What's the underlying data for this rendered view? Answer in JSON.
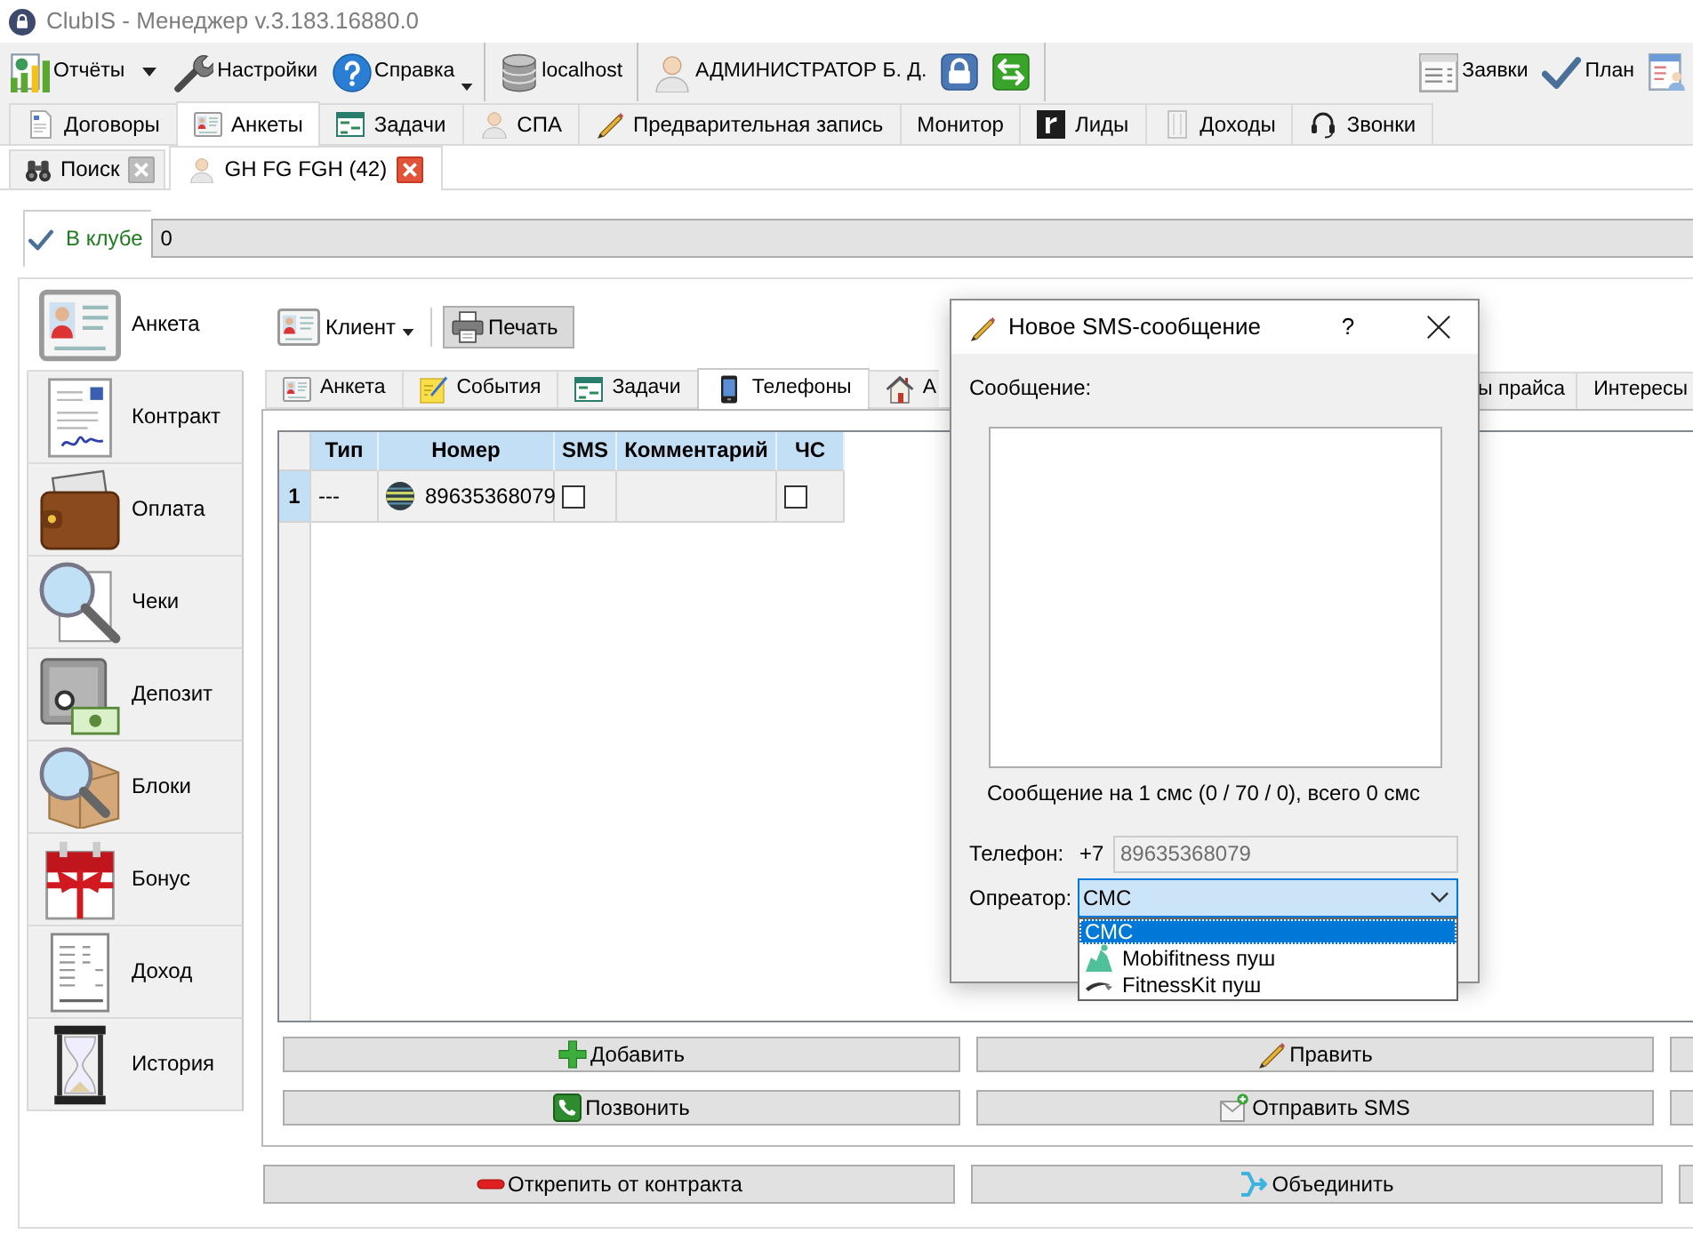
{
  "window": {
    "title": "ClubIS - Менеджер v.3.183.16880.0"
  },
  "toolbar": {
    "left": [
      {
        "kind": "split",
        "label": "Отчёты"
      },
      {
        "kind": "plain",
        "label": "Настройки"
      },
      {
        "kind": "menu",
        "label": "Справка"
      },
      {
        "kind": "separator"
      },
      {
        "kind": "plain",
        "label": "localhost"
      },
      {
        "kind": "separator"
      },
      {
        "kind": "plain",
        "label": "АДМИНИСТРАТОР Б. Д."
      },
      {
        "kind": "icon"
      },
      {
        "kind": "icon"
      },
      {
        "kind": "separator"
      }
    ],
    "right": [
      {
        "kind": "plain",
        "label": "Заявки"
      },
      {
        "kind": "plain",
        "label": "План"
      },
      {
        "kind": "icon"
      }
    ]
  },
  "main_tabs": [
    {
      "label": "Договоры",
      "selected": false
    },
    {
      "label": "Анкеты",
      "selected": true
    },
    {
      "label": "Задачи",
      "selected": false
    },
    {
      "label": "СПА",
      "selected": false
    },
    {
      "label": "Предварительная запись",
      "selected": false
    },
    {
      "label": "Монитор",
      "selected": false
    },
    {
      "label": "Лиды",
      "selected": false
    },
    {
      "label": "Доходы",
      "selected": false
    },
    {
      "label": "Звонки",
      "selected": false
    }
  ],
  "document_tabs": [
    {
      "label": "Поиск",
      "selected": false
    },
    {
      "label": "GH FG FGH (42)",
      "selected": true
    }
  ],
  "club_status": {
    "label": "В клубе",
    "value": "0"
  },
  "sidebar": {
    "items": [
      {
        "label": "Анкета",
        "selected": true
      },
      {
        "label": "Контракт",
        "selected": false
      },
      {
        "label": "Оплата",
        "selected": false
      },
      {
        "label": "Чеки",
        "selected": false
      },
      {
        "label": "Депозит",
        "selected": false
      },
      {
        "label": "Блоки",
        "selected": false
      },
      {
        "label": "Бонус",
        "selected": false
      },
      {
        "label": "Доход",
        "selected": false
      },
      {
        "label": "История",
        "selected": false
      }
    ]
  },
  "client_toolbar": [
    {
      "kind": "menu",
      "label": "Клиент"
    },
    {
      "kind": "button",
      "label": "Печать"
    }
  ],
  "client_tabs": [
    {
      "kind": "tab",
      "label": "Анкета",
      "selected": false
    },
    {
      "kind": "tab",
      "label": "События",
      "selected": false
    },
    {
      "kind": "tab",
      "label": "Задачи",
      "selected": false
    },
    {
      "kind": "tab",
      "label": "Телефоны",
      "selected": true
    },
    {
      "kind": "cut_end",
      "label": "А",
      "selected": false
    },
    {
      "kind": "cut_start",
      "label": "ы прайса",
      "selected": false
    },
    {
      "kind": "tab",
      "label": "Интересы",
      "selected": false
    }
  ],
  "phones_table": {
    "columns": [
      "Тип",
      "Номер",
      "SMS",
      "Комментарий",
      "ЧС"
    ],
    "rows": [
      {
        "row_number": "1",
        "type": "---",
        "number": "89635368079",
        "sms": false,
        "blacklist": false
      }
    ]
  },
  "phone_buttons": [
    [
      {
        "kind": "button",
        "label": "Добавить"
      },
      {
        "kind": "button",
        "label": "Править"
      },
      {
        "kind": "cut"
      }
    ],
    [
      {
        "kind": "button",
        "label": "Позвонить"
      },
      {
        "kind": "button",
        "label": "Отправить SMS"
      },
      {
        "kind": "cut"
      }
    ]
  ],
  "footer_buttons": [
    {
      "kind": "button",
      "label": "Открепить от контракта"
    },
    {
      "kind": "button",
      "label": "Объединить"
    },
    {
      "kind": "cut"
    }
  ],
  "sms_dialog": {
    "title": "Новое SMS-сообщение",
    "help": "?",
    "message_label": "Сообщение:",
    "counter": "Сообщение на 1 смс (0 / 70 / 0), всего 0 смс",
    "phone": {
      "label": "Телефон:",
      "prefix": "+7",
      "value": "89635368079",
      "disabled": true
    },
    "operator": {
      "label": "Опреатор:",
      "value": "СМС",
      "expanded": true,
      "options": [
        {
          "label": "СМС",
          "selected": true
        },
        {
          "label": "Mobifitness пуш",
          "selected": false
        },
        {
          "label": "FitnessKit пуш",
          "selected": false
        }
      ]
    }
  }
}
